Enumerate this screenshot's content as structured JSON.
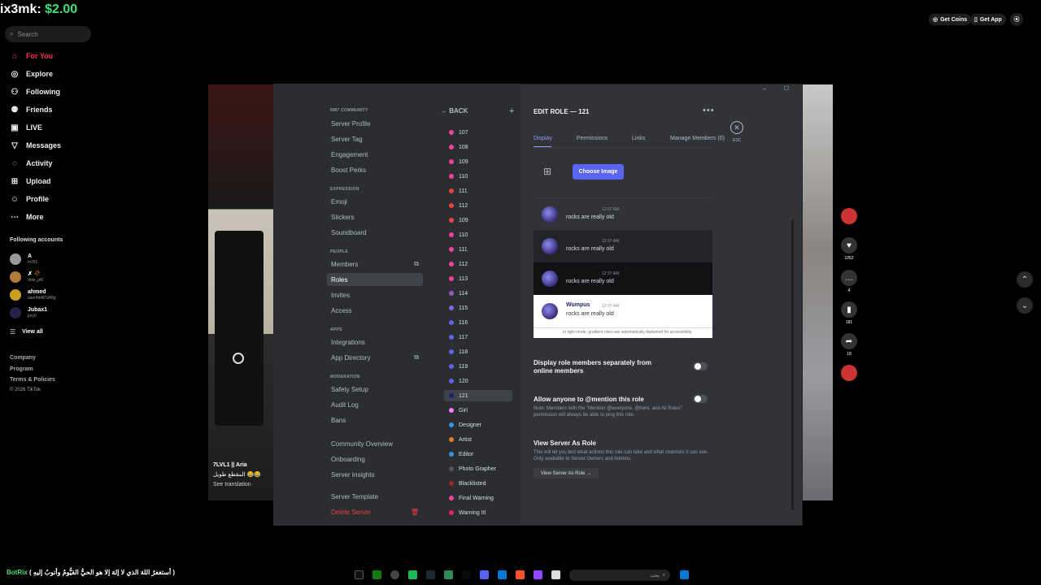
{
  "tiktok": {
    "donation": {
      "name": "ix3mk:",
      "amount": "$2.00"
    },
    "search_placeholder": "Search",
    "nav": [
      {
        "label": "For You",
        "icon": "home-icon"
      },
      {
        "label": "Explore",
        "icon": "compass-icon"
      },
      {
        "label": "Following",
        "icon": "following-icon"
      },
      {
        "label": "Friends",
        "icon": "friends-icon"
      },
      {
        "label": "LIVE",
        "icon": "live-icon"
      },
      {
        "label": "Messages",
        "icon": "messages-icon"
      },
      {
        "label": "Activity",
        "icon": "activity-icon"
      },
      {
        "label": "Upload",
        "icon": "upload-icon"
      },
      {
        "label": "Profile",
        "icon": "profile-icon"
      },
      {
        "label": "More",
        "icon": "more-icon"
      }
    ],
    "following_title": "Following accounts",
    "accounts": [
      {
        "name": "A",
        "handle": "m7fi1"
      },
      {
        "name": "✗ 🥀",
        "handle": "dole_pf0"
      },
      {
        "name": "ahmed",
        "handle": "user4d487zf6fg"
      },
      {
        "name": "Jubax1",
        "handle": "jury0"
      }
    ],
    "view_all": "View all",
    "footer": [
      "Company",
      "Program",
      "Terms & Policies",
      "© 2026 TikTok"
    ],
    "top_buttons": {
      "coins": "Get Coins",
      "app": "Get App"
    },
    "caption": {
      "author": "7LVL1 || Aria",
      "text": "المقطع طويل 😂😂",
      "translate": "See translation"
    },
    "actions": {
      "likes": "1052",
      "comments": "4",
      "saves": "181",
      "shares": "18"
    }
  },
  "discord": {
    "server_name": "RM7 COMMUNITY",
    "sidebar_sections": [
      {
        "header": "",
        "items": [
          "Server Profile",
          "Server Tag",
          "Engagement",
          "Boost Perks"
        ]
      },
      {
        "header": "EXPRESSION",
        "items": [
          "Emoji",
          "Stickers",
          "Soundboard"
        ]
      },
      {
        "header": "PEOPLE",
        "items": [
          "Members",
          "Roles",
          "Invites",
          "Access"
        ]
      },
      {
        "header": "APPS",
        "items": [
          "Integrations",
          "App Directory"
        ]
      },
      {
        "header": "MODERATION",
        "items": [
          "Safety Setup",
          "Audit Log",
          "Bans"
        ]
      },
      {
        "header": "",
        "items": [
          "Community Overview",
          "Onboarding",
          "Server Insights"
        ]
      },
      {
        "header": "",
        "items": [
          "Server Template",
          "Delete Server"
        ]
      }
    ],
    "back_label": "BACK",
    "roles": [
      {
        "name": "107",
        "color": "#eb459e"
      },
      {
        "name": "108",
        "color": "#eb459e"
      },
      {
        "name": "109",
        "color": "#eb459e"
      },
      {
        "name": "110",
        "color": "#eb459e"
      },
      {
        "name": "111",
        "color": "#ed4245"
      },
      {
        "name": "112",
        "color": "#ed4245"
      },
      {
        "name": "109",
        "color": "#ed4245"
      },
      {
        "name": "110",
        "color": "#eb459e"
      },
      {
        "name": "111",
        "color": "#eb459e"
      },
      {
        "name": "112",
        "color": "#eb459e"
      },
      {
        "name": "113",
        "color": "#eb459e"
      },
      {
        "name": "114",
        "color": "#9b59b6"
      },
      {
        "name": "115",
        "color": "#7b68ee"
      },
      {
        "name": "116",
        "color": "#5865f2"
      },
      {
        "name": "117",
        "color": "#5865f2"
      },
      {
        "name": "118",
        "color": "#5865f2"
      },
      {
        "name": "119",
        "color": "#5865f2"
      },
      {
        "name": "120",
        "color": "#5865f2"
      },
      {
        "name": "121",
        "color": "#1e1f6e"
      },
      {
        "name": "Girl",
        "color": "#f47fff"
      },
      {
        "name": "Designer",
        "color": "#3498db"
      },
      {
        "name": "Artist",
        "color": "#e67e22"
      },
      {
        "name": "Editor",
        "color": "#3498db"
      },
      {
        "name": "Photo Grapher",
        "color": "#555555"
      },
      {
        "name": "Blacklisted",
        "color": "#992d22"
      },
      {
        "name": "Final Warning",
        "color": "#eb459e"
      },
      {
        "name": "Warning III",
        "color": "#e91e63"
      }
    ],
    "edit_title": "EDIT ROLE — 121",
    "esc_label": "ESC",
    "tabs": [
      "Display",
      "Permissions",
      "Links",
      "Manage Members (0)"
    ],
    "choose_image": "Choose Image",
    "preview": {
      "username": "Wumpus",
      "time": "12:37 AM",
      "message": "rocks are really old",
      "note": "In light mode, gradient roles are automatically darkened for accessibility."
    },
    "options": {
      "display_sep": "Display role members separately from online members",
      "mention_title": "Allow anyone to @mention this role",
      "mention_note": "Note: Members with the \"Mention @everyone, @here, and All Roles\" permission will always be able to ping this role.",
      "view_as_title": "View Server As Role",
      "view_as_note": "This will let you test what actions this role can take and what channels it can see. Only available to Server Owners and Admins.",
      "view_as_btn": "View Server As Role →"
    },
    "colors": {
      "accent": "#5865f2",
      "danger": "#f23f42",
      "bg": "#313338",
      "sidebar": "#2b2d31"
    }
  },
  "taskbar": {
    "text_prefix": "( أستغفرُ اللهَ الذي لا إلهَ إلا هو الحيُّ القيُّومُ وأتوبُ إليهِ )",
    "brand": "BotRix",
    "search_placeholder": "بحث"
  }
}
